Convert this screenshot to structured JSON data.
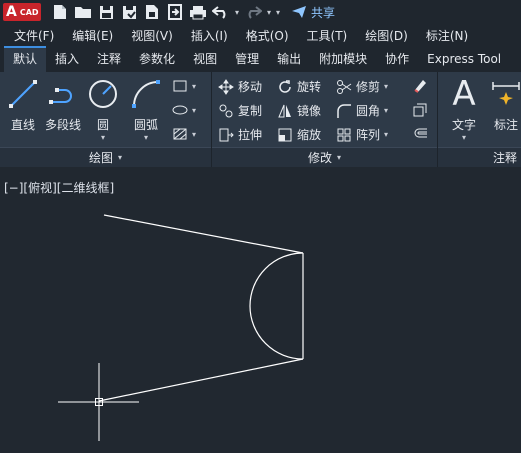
{
  "app": {
    "logo_letter": "A",
    "logo_text": "CAD",
    "brand_color": "#c8242b",
    "accent": "#3d8ee0"
  },
  "quick_access": {
    "icons": [
      "new-file-icon",
      "open-folder-icon",
      "save-icon",
      "save-as-icon",
      "publish-icon",
      "import-icon",
      "print-icon",
      "undo-icon",
      "redo-icon",
      "customize-icon"
    ],
    "share_label": "共享"
  },
  "menu": [
    "文件(F)",
    "编辑(E)",
    "视图(V)",
    "插入(I)",
    "格式(O)",
    "工具(T)",
    "绘图(D)",
    "标注(N)"
  ],
  "tabs": [
    "默认",
    "插入",
    "注释",
    "参数化",
    "视图",
    "管理",
    "输出",
    "附加模块",
    "协作",
    "Express Tool"
  ],
  "active_tab": "默认",
  "draw_panel": {
    "title": "绘图",
    "tools": {
      "line": "直线",
      "polyline": "多段线",
      "circle": "圆",
      "arc": "圆弧"
    }
  },
  "modify_panel": {
    "title": "修改",
    "tools": {
      "move": "移动",
      "rotate": "旋转",
      "trim": "修剪",
      "copy": "复制",
      "mirror": "镜像",
      "fillet": "圆角",
      "stretch": "拉伸",
      "scale": "缩放",
      "array": "阵列"
    }
  },
  "annotation_panel": {
    "title": "注释",
    "tools": {
      "text": "文字",
      "dimension": "标注"
    }
  },
  "viewport": {
    "label": "[−][俯视][二维线框]"
  }
}
